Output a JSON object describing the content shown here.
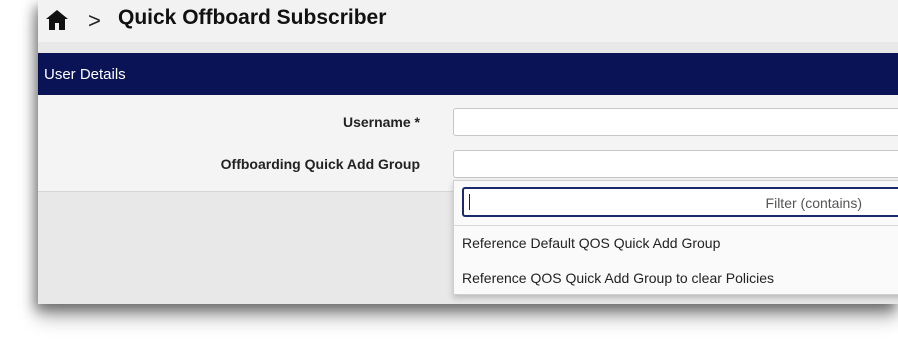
{
  "header": {
    "home_icon": "home-icon",
    "breadcrumb_separator": ">",
    "title": "Quick Offboard Subscriber"
  },
  "section": {
    "title": "User Details"
  },
  "form": {
    "username_label": "Username *",
    "username_value": "",
    "group_label": "Offboarding Quick Add Group",
    "group_value": ""
  },
  "dropdown": {
    "filter_placeholder": "Filter (contains)",
    "options": [
      "Reference Default QOS Quick Add Group",
      "Reference QOS Quick Add Group to clear Policies"
    ]
  },
  "colors": {
    "section_header_bg": "#0b1357",
    "filter_border": "#1a2a6c"
  }
}
